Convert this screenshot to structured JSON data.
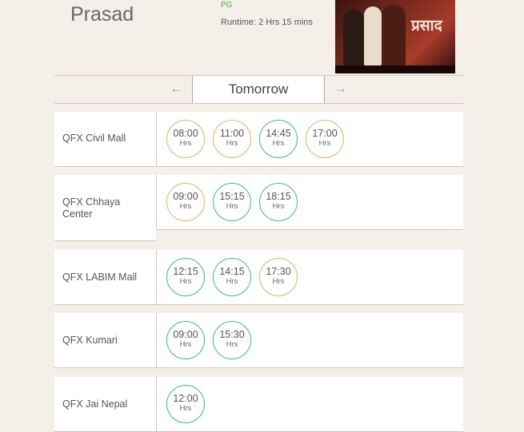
{
  "movie": {
    "title": "Prasad",
    "rating": "PG",
    "runtime": "Runtime: 2 Hrs 15 mins",
    "poster_icon": "movie-poster"
  },
  "date_nav": {
    "prev_arrow": "←",
    "label": "Tomorrow",
    "next_arrow": "→"
  },
  "colors": {
    "orange": "#e5ad6a",
    "teal": "#3bb3a5",
    "rating": "#5aa83c"
  },
  "cinemas": [
    {
      "name": "QFX Civil Mall",
      "times": [
        {
          "time": "08:00",
          "unit": "Hrs",
          "color": "orange"
        },
        {
          "time": "11:00",
          "unit": "Hrs",
          "color": "orange"
        },
        {
          "time": "14:45",
          "unit": "Hrs",
          "color": "teal"
        },
        {
          "time": "17:00",
          "unit": "Hrs",
          "color": "orange"
        }
      ]
    },
    {
      "name": "QFX Chhaya Center",
      "times": [
        {
          "time": "09:00",
          "unit": "Hrs",
          "color": "orange"
        },
        {
          "time": "15:15",
          "unit": "Hrs",
          "color": "teal"
        },
        {
          "time": "18:15",
          "unit": "Hrs",
          "color": "teal"
        }
      ]
    },
    {
      "name": "QFX LABIM Mall",
      "times": [
        {
          "time": "12:15",
          "unit": "Hrs",
          "color": "teal"
        },
        {
          "time": "14:15",
          "unit": "Hrs",
          "color": "teal"
        },
        {
          "time": "17:30",
          "unit": "Hrs",
          "color": "orange"
        }
      ]
    },
    {
      "name": "QFX Kumari",
      "times": [
        {
          "time": "09:00",
          "unit": "Hrs",
          "color": "teal"
        },
        {
          "time": "15:30",
          "unit": "Hrs",
          "color": "teal"
        }
      ]
    },
    {
      "name": "QFX Jai Nepal",
      "times": [
        {
          "time": "12:00",
          "unit": "Hrs",
          "color": "teal"
        }
      ]
    }
  ]
}
